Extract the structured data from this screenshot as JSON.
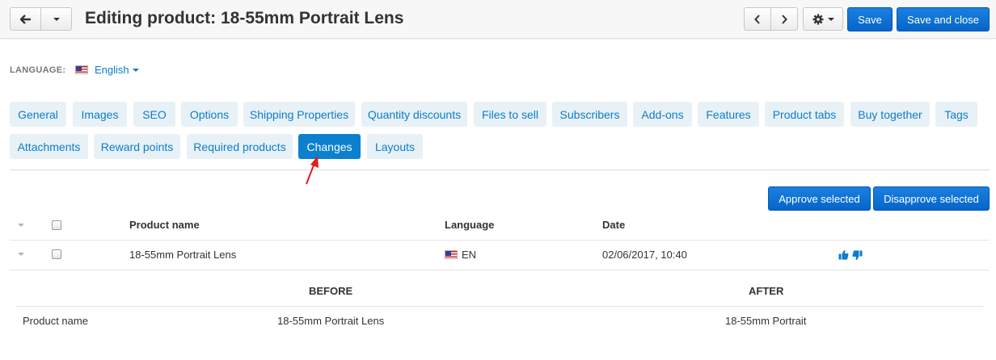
{
  "header": {
    "title": "Editing product: 18-55mm Portrait Lens",
    "save_label": "Save",
    "save_close_label": "Save and close",
    "back_icon": "arrow-left-icon",
    "gear_icon": "gear-icon"
  },
  "language": {
    "label": "LANGUAGE:",
    "selected": "English"
  },
  "tabs_row1": [
    "General",
    "Images",
    "SEO",
    "Options",
    "Shipping Properties",
    "Quantity discounts",
    "Files to sell",
    "Subscribers",
    "Add-ons",
    "Features",
    "Product tabs",
    "Buy together",
    "Tags"
  ],
  "tabs_row2": [
    "Attachments",
    "Reward points",
    "Required products",
    "Changes",
    "Layouts"
  ],
  "active_tab": "Changes",
  "actions": {
    "approve_label": "Approve selected",
    "disapprove_label": "Disapprove selected"
  },
  "table": {
    "headers": {
      "product": "Product name",
      "language": "Language",
      "date": "Date"
    },
    "row": {
      "product": "18-55mm Portrait Lens",
      "language": "EN",
      "date": "02/06/2017, 10:40"
    }
  },
  "details": {
    "before_label": "BEFORE",
    "after_label": "AFTER",
    "field_name": "Product name",
    "before_value": "18-55mm Portrait Lens",
    "after_value": "18-55mm Portrait"
  },
  "colors": {
    "accent": "#0b7dcc",
    "primary_button": "#0b72d6",
    "tab_bg": "#e8f1f6",
    "annotation_arrow": "#e0201b"
  }
}
